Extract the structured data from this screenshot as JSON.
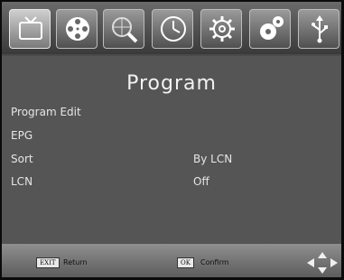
{
  "tabs": [
    {
      "icon": "tv-icon",
      "active": true
    },
    {
      "icon": "film-reel-icon",
      "active": false
    },
    {
      "icon": "search-globe-icon",
      "active": false
    },
    {
      "icon": "clock-icon",
      "active": false
    },
    {
      "icon": "settings-gear-icon",
      "active": false
    },
    {
      "icon": "tools-gears-icon",
      "active": false
    },
    {
      "icon": "usb-icon",
      "active": false
    }
  ],
  "page": {
    "title": "Program"
  },
  "menu": [
    {
      "label": "Program Edit",
      "value": ""
    },
    {
      "label": "EPG",
      "value": ""
    },
    {
      "label": "Sort",
      "value": "By LCN"
    },
    {
      "label": "LCN",
      "value": "Off"
    }
  ],
  "footer": {
    "exit_key": "EXIT",
    "exit_label": "Return",
    "ok_key": "OK",
    "ok_label": "Confirm",
    "nav_icon": "dpad-arrows-icon"
  }
}
